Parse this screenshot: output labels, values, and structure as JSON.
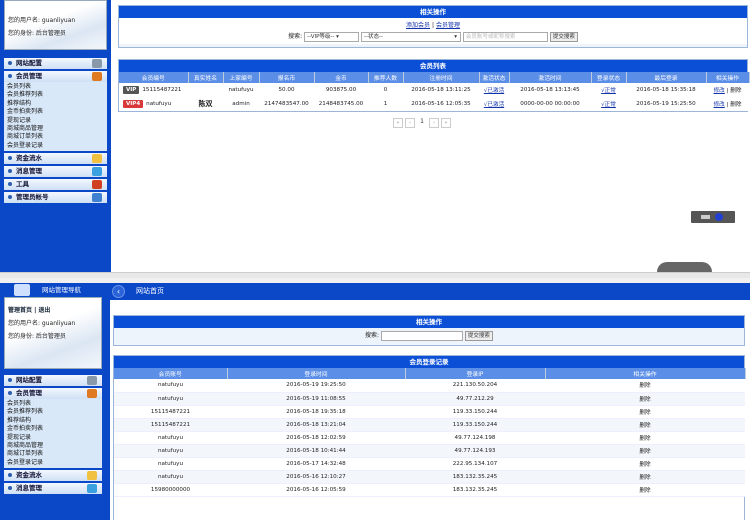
{
  "sidebar_top": {
    "username_label": "您的用户名: guanliyuan",
    "role_label": "您的身份: 后台管理员",
    "menu": [
      {
        "label": "网站配置",
        "color": "#8899aa"
      },
      {
        "label": "会员管理",
        "color": "#e07a20"
      },
      {
        "label": "资金流水",
        "color": "#f0c040"
      },
      {
        "label": "消息管理",
        "color": "#3aa0e0"
      },
      {
        "label": "工具",
        "color": "#d04020"
      },
      {
        "label": "管理员帐号",
        "color": "#4080d0"
      }
    ],
    "submenu": [
      "会员列表",
      "会员推荐列表",
      "推荐结构",
      "金币拍卖列表",
      "提现记录",
      "商城商品管理",
      "商城订单列表",
      "会员登录记录"
    ]
  },
  "ops_panel": {
    "title": "相关操作",
    "link_add": "添加会员",
    "separator": "|",
    "link_manage": "会员管理",
    "search_label": "搜索:",
    "vip_select": "--VIP等级-- ▾",
    "status_select": "--状态--",
    "search_placeholder": "会员账号或昵称搜索",
    "submit": "提交搜索"
  },
  "member_table": {
    "title": "会员列表",
    "headers": [
      "会员编号",
      "真实姓名",
      "上家编号",
      "报名币",
      "金币",
      "推荐人数",
      "注册时间",
      "激活状态",
      "激活时间",
      "登录状态",
      "最后登录",
      "相关操作"
    ],
    "rows": [
      {
        "badge": "VIP",
        "badge_color": "#555555",
        "cells": [
          "15115487221",
          "",
          "natufuyu",
          "50.00",
          "903875.00",
          "0",
          "2016-05-18 13:11:25",
          "√已激活",
          "2016-05-18 13:13:45",
          "√正常",
          "2016-05-18 15:35:18"
        ],
        "edit": "修改",
        "delete": "删除"
      },
      {
        "badge": "VIP4",
        "badge_color": "#d9383a",
        "cells": [
          "natufuyu",
          "陈双",
          "admin",
          "2147483547.00",
          "2148483745.00",
          "1",
          "2016-05-16 12:05:35",
          "√已激活",
          "0000-00-00 00:00:00",
          "√正常",
          "2016-05-19 15:25:50"
        ],
        "edit": "修改",
        "delete": "删除"
      }
    ]
  },
  "pager": {
    "first": "«",
    "prev": "‹",
    "current": "1",
    "next": "›",
    "last": "»"
  },
  "sidebar_bottom": {
    "title": "网站管理导航",
    "home_link": "管理首页",
    "sep": "|",
    "logout_link": "退出",
    "username_label": "您的用户名: guanliyuan",
    "role_label": "您的身份: 后台管理员",
    "menu": [
      {
        "label": "网站配置",
        "color": "#8899aa"
      },
      {
        "label": "会员管理",
        "color": "#e07a20"
      },
      {
        "label": "资金流水",
        "color": "#f0c040"
      },
      {
        "label": "消息管理",
        "color": "#3aa0e0"
      }
    ],
    "submenu": [
      "会员列表",
      "会员推荐列表",
      "推荐结构",
      "金币拍卖列表",
      "提现记录",
      "商城商品管理",
      "商城订单列表",
      "会员登录记录"
    ]
  },
  "topbar": {
    "back": "‹",
    "title": "网站首页"
  },
  "ops2": {
    "title": "相关操作",
    "search_label": "搜索:",
    "submit": "提交搜索"
  },
  "login_table": {
    "title": "会员登录记录",
    "headers": [
      "会员账号",
      "登录时间",
      "登录IP",
      "相关操作"
    ],
    "rows": [
      [
        "natufuyu",
        "2016-05-19 19:25:50",
        "221.130.50.204",
        "删除"
      ],
      [
        "natufuyu",
        "2016-05-19 11:08:55",
        "49.77.212.29",
        "删除"
      ],
      [
        "15115487221",
        "2016-05-18 19:35:18",
        "119.33.150.244",
        "删除"
      ],
      [
        "15115487221",
        "2016-05-18 13:21:04",
        "119.33.150.244",
        "删除"
      ],
      [
        "natufuyu",
        "2016-05-18 12:02:59",
        "49.77.124.198",
        "删除"
      ],
      [
        "natufuyu",
        "2016-05-18 10:41:44",
        "49.77.124.193",
        "删除"
      ],
      [
        "natufuyu",
        "2016-05-17 14:32:48",
        "222.95.134.107",
        "删除"
      ],
      [
        "natufuyu",
        "2016-05-16 12:10:27",
        "183.132.35.245",
        "删除"
      ],
      [
        "15980000000",
        "2016-05-16 12:05:59",
        "183.132.35.245",
        "删除"
      ]
    ]
  }
}
